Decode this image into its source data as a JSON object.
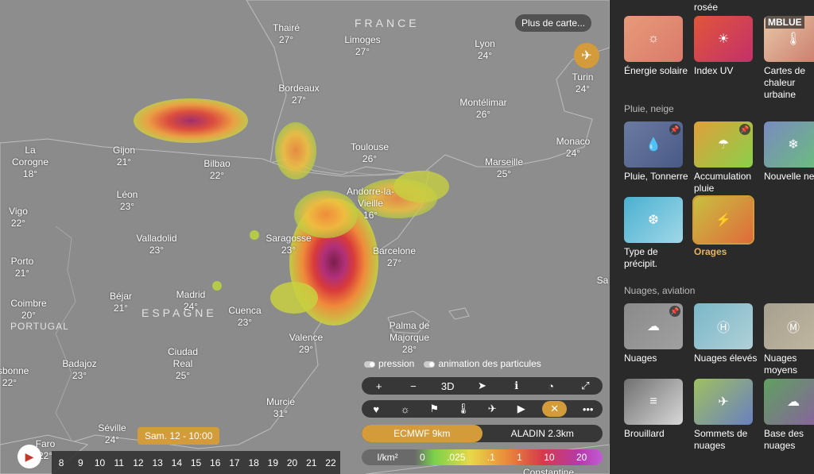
{
  "map": {
    "more_maps": "Plus de carte...",
    "countries": {
      "france": "FRANCE",
      "espagne": "ESPAGNE",
      "portugal": "PORTUGAL"
    },
    "cities": [
      {
        "name": "Thairé",
        "temp": "27°"
      },
      {
        "name": "Limoges",
        "temp": "27°"
      },
      {
        "name": "Lyon",
        "temp": "24°"
      },
      {
        "name": "Turin",
        "temp": "24°"
      },
      {
        "name": "Bordeaux",
        "temp": "27°"
      },
      {
        "name": "Montélimar",
        "temp": "26°"
      },
      {
        "name": "Monaco",
        "temp": "24°"
      },
      {
        "name": "Gijon",
        "temp": "21°"
      },
      {
        "name": "Bilbao",
        "temp": "22°"
      },
      {
        "name": "Toulouse",
        "temp": "26°"
      },
      {
        "name": "Marseille",
        "temp": "25°"
      },
      {
        "name": "La Corogne",
        "temp": "18°"
      },
      {
        "name": "Léon",
        "temp": "23°"
      },
      {
        "name": "Andorre-la-Vieille",
        "temp": "16°"
      },
      {
        "name": "Vigo",
        "temp": "22°"
      },
      {
        "name": "Valladolid",
        "temp": "23°"
      },
      {
        "name": "Saragosse",
        "temp": "23°"
      },
      {
        "name": "Barcelone",
        "temp": "27°"
      },
      {
        "name": "Porto",
        "temp": "21°"
      },
      {
        "name": "Béjar",
        "temp": "21°"
      },
      {
        "name": "Madrid",
        "temp": "24°"
      },
      {
        "name": "Coimbre",
        "temp": "20°"
      },
      {
        "name": "Cuenca",
        "temp": "23°"
      },
      {
        "name": "Palma de Majorque",
        "temp": "28°"
      },
      {
        "name": "Valence",
        "temp": "29°"
      },
      {
        "name": "Ciudad Real",
        "temp": "25°"
      },
      {
        "name": "Badajoz",
        "temp": "23°"
      },
      {
        "name": "Lisbonne",
        "temp": "22°"
      },
      {
        "name": "Murcie",
        "temp": "31°"
      },
      {
        "name": "Séville",
        "temp": "24°"
      },
      {
        "name": "Faro",
        "temp": "22°"
      },
      {
        "name": "Constantine",
        "temp": ""
      },
      {
        "name": "Sa",
        "temp": ""
      }
    ]
  },
  "toggles": {
    "pressure": "pression",
    "particles": "animation des particules"
  },
  "toolbar1": [
    "+",
    "−",
    "3D",
    "➤",
    "ℹ",
    "◔",
    "⤢"
  ],
  "toolbar2": [
    "♥",
    "☼",
    "⚑",
    "🌡",
    "✈",
    "▶",
    "✕",
    "•••"
  ],
  "models": [
    {
      "name": "ECMWF",
      "res": "9km",
      "active": true
    },
    {
      "name": "ALADIN",
      "res": "2.3km",
      "active": false
    }
  ],
  "legend": {
    "unit": "l/km²",
    "values": [
      "0",
      ".025",
      ".1",
      "1",
      "10",
      "20"
    ]
  },
  "timeline": {
    "badge": "Sam. 12 - 10:00",
    "hours": [
      "8",
      "9",
      "10",
      "11",
      "12",
      "13",
      "14",
      "15",
      "16",
      "17",
      "18",
      "19",
      "20",
      "21",
      "22"
    ]
  },
  "panel": {
    "top_label": "rosée",
    "sections": [
      {
        "title": "",
        "tiles": [
          {
            "label": "Énergie solaire",
            "icon": "sun-icon",
            "pinned": false,
            "selected": false,
            "colors": [
              "#e89a7a",
              "#d97a6a"
            ]
          },
          {
            "label": "Index UV",
            "icon": "uv-icon",
            "pinned": false,
            "selected": false,
            "colors": [
              "#e0563a",
              "#c4306a"
            ]
          },
          {
            "label": "Cartes de chaleur urbaine",
            "icon": "thermometer-icon",
            "pinned": false,
            "selected": false,
            "badge": "MBLUE",
            "colors": [
              "#e8c8a8",
              "#c97a6a"
            ]
          }
        ]
      },
      {
        "title": "Pluie, neige",
        "tiles": [
          {
            "label": "Pluie, Tonnerre",
            "icon": "raindrop-icon",
            "pinned": true,
            "selected": false,
            "colors": [
              "#6a7aa0",
              "#4a5a88"
            ]
          },
          {
            "label": "Accumulation pluie",
            "icon": "rain-cloud-icon",
            "pinned": true,
            "selected": false,
            "colors": [
              "#e0a03a",
              "#8ad04a"
            ]
          },
          {
            "label": "Nouvelle neige",
            "icon": "snowflake-icon",
            "pinned": false,
            "selected": false,
            "colors": [
              "#7a8ac0",
              "#6ac07a"
            ]
          }
        ]
      },
      {
        "title": "",
        "tiles": [
          {
            "label": "Type de précipit.",
            "icon": "precip-type-icon",
            "pinned": false,
            "selected": false,
            "colors": [
              "#4ab0d0",
              "#a0d8e8"
            ]
          },
          {
            "label": "Orages",
            "icon": "storm-icon",
            "pinned": false,
            "selected": true,
            "colors": [
              "#c8c040",
              "#e06a3a"
            ]
          }
        ]
      },
      {
        "title": "Nuages, aviation",
        "tiles": [
          {
            "label": "Nuages",
            "icon": "cloud-icon",
            "pinned": true,
            "selected": false,
            "colors": [
              "#8a8a8a",
              "#a0a0a0"
            ]
          },
          {
            "label": "Nuages élevés",
            "icon": "high-cloud-icon",
            "pinned": false,
            "selected": false,
            "colors": [
              "#7ab8c8",
              "#b0d0d8"
            ]
          },
          {
            "label": "Nuages moyens",
            "icon": "mid-cloud-icon",
            "pinned": false,
            "selected": false,
            "colors": [
              "#a8a090",
              "#c0b8a0"
            ]
          }
        ]
      },
      {
        "title": "",
        "tiles": [
          {
            "label": "Brouillard",
            "icon": "fog-icon",
            "pinned": false,
            "selected": false,
            "colors": [
              "#707070",
              "#d8d8d8"
            ]
          },
          {
            "label": "Sommets de nuages",
            "icon": "plane-icon",
            "pinned": false,
            "selected": false,
            "colors": [
              "#a0c060",
              "#6a80c0"
            ]
          },
          {
            "label": "Base des nuages",
            "icon": "cloud-base-icon",
            "pinned": false,
            "selected": false,
            "colors": [
              "#60a060",
              "#8a60a0"
            ]
          }
        ]
      }
    ]
  }
}
